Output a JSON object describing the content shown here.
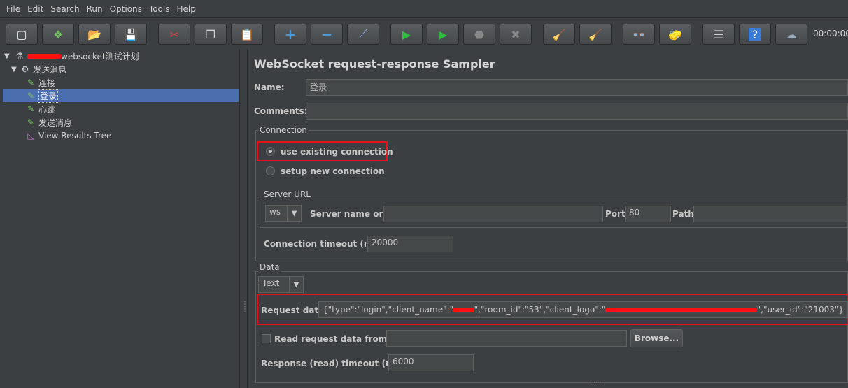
{
  "menu": [
    "File",
    "Edit",
    "Search",
    "Run",
    "Options",
    "Help"
  ],
  "menu_tools": "Tools",
  "toolbar": {
    "timer": "00:00:00",
    "icons": [
      "new-icon",
      "templates-icon",
      "open-icon",
      "save-icon",
      "cut-icon",
      "copy-icon",
      "paste-icon",
      "expand-icon",
      "collapse-icon",
      "toggle-icon",
      "start-icon",
      "start-no-pause-icon",
      "stop-icon",
      "shutdown-icon",
      "clear-icon",
      "clear-all-icon",
      "search-icon",
      "reset-search-icon",
      "function-helper-icon",
      "help-icon",
      "remote-icon"
    ],
    "glyphs": [
      "▢",
      "❖",
      "📂",
      "💾",
      "✂",
      "❐",
      "📋",
      "+",
      "−",
      "⟋",
      "▶",
      "▶",
      "⬣",
      "✖",
      "🧹",
      "🧹",
      "👓",
      "🧽",
      "☰",
      "?",
      "☁"
    ]
  },
  "tree": {
    "plan": "websocket测试计划",
    "thread_group": "发送消息",
    "items": [
      "连接",
      "登录",
      "心跳",
      "发送消息"
    ],
    "listener": "View Results Tree"
  },
  "sampler": {
    "title": "WebSocket request-response Sampler",
    "name_label": "Name:",
    "name_value": "登录",
    "comments_label": "Comments:",
    "comments_value": "",
    "connection_label": "Connection",
    "use_existing": "use existing connection",
    "setup_new": "setup new connection",
    "server_url_label": "Server URL",
    "protocol": "ws",
    "server_label": "Server name or IP:",
    "server_value": "",
    "port_label": "Port:",
    "port_value": "80",
    "path_label": "Path:",
    "path_value": "",
    "timeout_label": "Connection timeout (ms):",
    "timeout_value": "20000",
    "data_label": "Data",
    "data_type": "Text",
    "request_label": "Request data:",
    "request_part1": "{\"type\":\"login\",\"client_name\":\"",
    "request_part2": "\",\"room_id\":\"53\",\"client_logo\":\"",
    "request_part3": "\",\"user_id\":\"21003\"}",
    "read_file_label": "Read request data from file:",
    "read_file_value": "",
    "browse": "Browse...",
    "response_timeout_label": "Response (read) timeout (ms):",
    "response_timeout_value": "6000"
  }
}
